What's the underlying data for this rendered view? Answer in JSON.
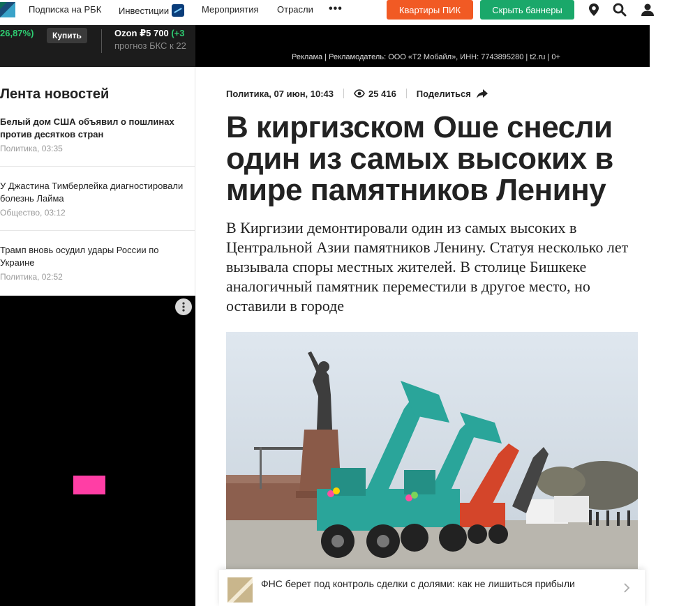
{
  "nav": {
    "subscription": "Подписка на РБК",
    "investments": "Инвестиции",
    "events": "Мероприятия",
    "industries": "Отрасли",
    "more": "•••",
    "btn_apartments": "Квартиры ПИК",
    "btn_hide_banners": "Скрыть баннеры"
  },
  "ticker": {
    "percent": "26,87%)",
    "buy_label": "Купить",
    "stock_name": "Ozon ₽5 700",
    "stock_change": "(+3",
    "forecast": "прогноз БКС к 22"
  },
  "ad": {
    "disclaimer": "Реклама | Рекламодатель: ООО «Т2 Мобайл», ИНН: 7743895280 | t2.ru | 0+"
  },
  "feed": {
    "title": "Лента новостей",
    "items": [
      {
        "title": "Белый дом США объявил о пошлинах против десятков стран",
        "meta": "Политика, 03:35",
        "bold": true
      },
      {
        "title": "У Джастина Тимберлейка диагностировали болезнь Лайма",
        "meta": "Общество, 03:12",
        "bold": false
      },
      {
        "title": "Трамп вновь осудил удары России по Украине",
        "meta": "Политика, 02:52",
        "bold": false
      }
    ]
  },
  "article": {
    "category_date": "Политика, 07 июн, 10:43",
    "views": "25 416",
    "share_label": "Поделиться",
    "headline": "В киргизском Оше снесли один из самых высоких в мире памятников Ленину",
    "lead": "В Киргизии демонтировали один из самых высоких в Центральной Азии памятников Ленину. Статуя несколько лет вызывала споры местных жителей. В столице Бишкеке аналогичный памятник переместили в другое место, но оставили в городе"
  },
  "promo": {
    "text": "ФНС берет под контроль сделки с долями: как не лишиться прибыли"
  },
  "colors": {
    "orange": "#f15a24",
    "green": "#1aa86a",
    "ticker_up": "#2ecc71",
    "ad_pink": "#ff3ea5"
  }
}
